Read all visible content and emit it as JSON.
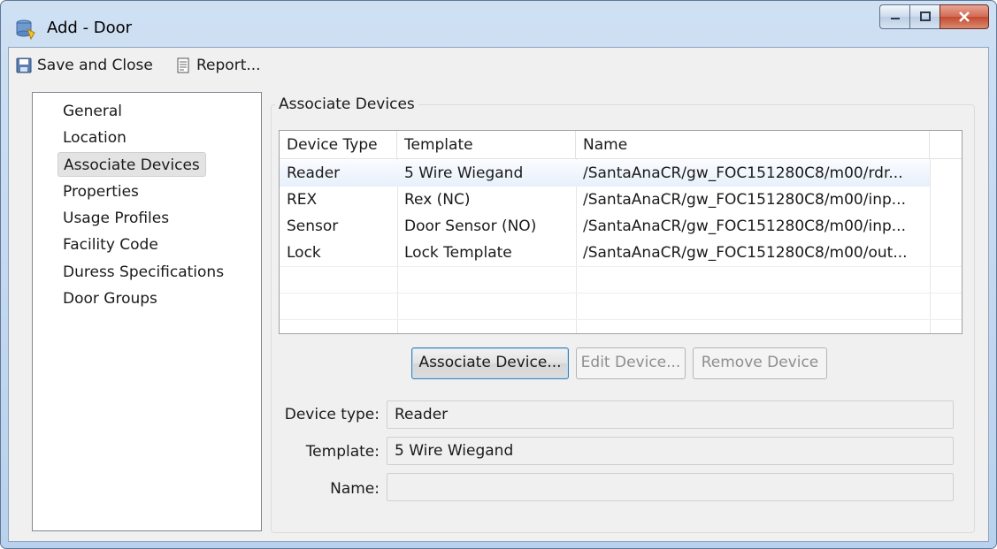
{
  "window": {
    "title": "Add - Door",
    "app_icon": "database-door-icon"
  },
  "toolbar": {
    "save_label": "Save and Close",
    "report_label": "Report..."
  },
  "nav": {
    "items": [
      {
        "label": "General"
      },
      {
        "label": "Location"
      },
      {
        "label": "Associate Devices",
        "selected": true
      },
      {
        "label": "Properties"
      },
      {
        "label": "Usage Profiles"
      },
      {
        "label": "Facility Code"
      },
      {
        "label": "Duress Specifications"
      },
      {
        "label": "Door Groups"
      }
    ]
  },
  "section": {
    "title": "Associate Devices"
  },
  "table": {
    "headers": [
      "Device Type",
      "Template",
      "Name"
    ],
    "rows": [
      {
        "type": "Reader",
        "template": "5 Wire Wiegand",
        "name": "/SantaAnaCR/gw_FOC151280C8/m00/rdr...",
        "selected": true
      },
      {
        "type": "REX",
        "template": "Rex (NC)",
        "name": "/SantaAnaCR/gw_FOC151280C8/m00/inp..."
      },
      {
        "type": "Sensor",
        "template": "Door Sensor (NO)",
        "name": "/SantaAnaCR/gw_FOC151280C8/m00/inp..."
      },
      {
        "type": "Lock",
        "template": "Lock Template",
        "name": "/SantaAnaCR/gw_FOC151280C8/m00/out..."
      }
    ]
  },
  "buttons": {
    "associate": "Associate Device...",
    "edit": "Edit Device...",
    "remove": "Remove Device"
  },
  "details": {
    "device_type_label": "Device type:",
    "device_type_value": "Reader",
    "template_label": "Template:",
    "template_value": "5 Wire Wiegand",
    "name_label": "Name:",
    "name_value": ""
  },
  "colors": {
    "title_bar": "#cfe0f3",
    "close_button": "#c9503a",
    "selection": "#e7f0fb"
  }
}
